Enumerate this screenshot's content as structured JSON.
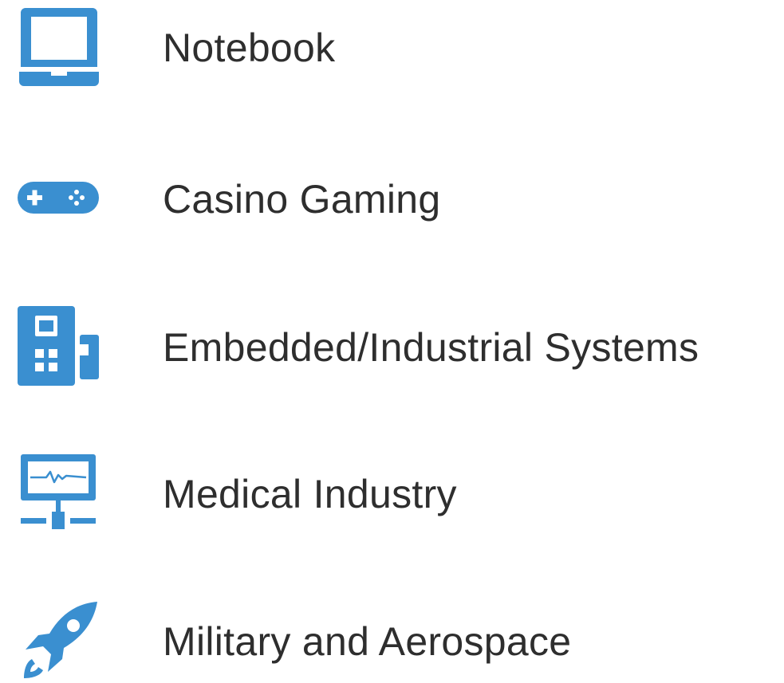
{
  "theme": {
    "icon_color": "#3a8fd0",
    "text_color": "#2e2e2e",
    "background": "#ffffff"
  },
  "items": [
    {
      "label": "Notebook",
      "icon": "laptop-icon"
    },
    {
      "label": "Casino Gaming",
      "icon": "gamepad-icon"
    },
    {
      "label": "Embedded/Industrial Systems",
      "icon": "industrial-device-icon"
    },
    {
      "label": "Medical Industry",
      "icon": "medical-monitor-icon"
    },
    {
      "label": "Military and Aerospace",
      "icon": "rocket-icon"
    }
  ]
}
